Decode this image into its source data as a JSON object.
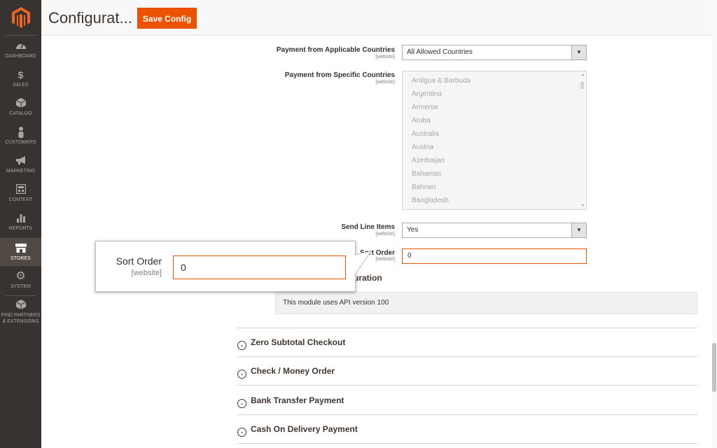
{
  "sidebar": {
    "items": [
      {
        "label": "DASHBOARD",
        "icon": "dashboard-icon"
      },
      {
        "label": "SALES",
        "icon": "dollar-icon"
      },
      {
        "label": "CATALOG",
        "icon": "box-icon"
      },
      {
        "label": "CUSTOMERS",
        "icon": "person-icon"
      },
      {
        "label": "MARKETING",
        "icon": "megaphone-icon"
      },
      {
        "label": "CONTENT",
        "icon": "layout-icon"
      },
      {
        "label": "REPORTS",
        "icon": "bar-chart-icon"
      },
      {
        "label": "STORES",
        "icon": "store-icon"
      },
      {
        "label": "SYSTEM",
        "icon": "gear-icon"
      },
      {
        "label_line1": "FIND PARTNERS",
        "label_line2": "& EXTENSIONS",
        "icon": "cube-icon"
      }
    ],
    "active": "STORES"
  },
  "header": {
    "title": "Configurat...",
    "save_label": "Save Config"
  },
  "form": {
    "applicable_countries": {
      "label": "Payment from Applicable Countries",
      "scope": "[website]",
      "value": "All Allowed Countries"
    },
    "specific_countries": {
      "label": "Payment from Specific Countries",
      "scope": "[website]",
      "options": [
        "Antigua & Barbuda",
        "Argentina",
        "Armenia",
        "Aruba",
        "Australia",
        "Austria",
        "Azerbaijan",
        "Bahamas",
        "Bahrain",
        "Bangladesh"
      ]
    },
    "send_line_items": {
      "label": "Send Line Items",
      "scope": "[website]",
      "value": "Yes"
    },
    "sort_order": {
      "label": "Sort Order",
      "scope": "[website]",
      "value": "0"
    },
    "section_partial_title": "uration",
    "api_note": "This module uses API version 100"
  },
  "accordion": [
    {
      "label": "Zero Subtotal Checkout"
    },
    {
      "label": "Check / Money Order"
    },
    {
      "label": "Bank Transfer Payment"
    },
    {
      "label": "Cash On Delivery Payment"
    }
  ],
  "callout": {
    "label": "Sort Order",
    "scope": "[website]",
    "value": "0"
  },
  "colors": {
    "accent": "#eb5202",
    "sidebar": "#373330"
  }
}
